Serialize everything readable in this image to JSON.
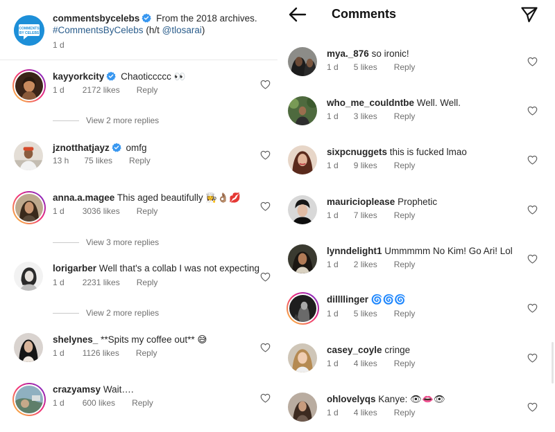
{
  "post": {
    "caption_user": "commentsbycelebs",
    "caption_text": "From the 2018 archives.",
    "caption_tags": "#CommentsByCelebs",
    "caption_credit_pre": "(h/t",
    "caption_credit_user": "@tlosarai",
    "caption_credit_post": ")",
    "caption_time": "1 d",
    "logo_text_1": "COMMENTS",
    "logo_text_2": "BY CELEBS"
  },
  "left_comments": [
    {
      "user": "kayyorkcity",
      "verified": true,
      "text": "Chaoticcccc",
      "emoji": "👀",
      "time": "1 d",
      "likes": "2172 likes",
      "reply": "Reply"
    },
    {
      "user": "jznotthatjayz",
      "verified": true,
      "text": "omfg",
      "emoji": "",
      "time": "13 h",
      "likes": "75 likes",
      "reply": "Reply"
    },
    {
      "user": "anna.a.magee",
      "verified": false,
      "text": "This aged beautifully",
      "emoji": "👩‍🍳👌🏽💋",
      "time": "1 d",
      "likes": "3036 likes",
      "reply": "Reply"
    },
    {
      "user": "lorigarber",
      "verified": false,
      "text": "Well that's a collab I was not expecting",
      "emoji": "",
      "time": "1 d",
      "likes": "2231 likes",
      "reply": "Reply"
    },
    {
      "user": "shelynes_",
      "verified": false,
      "text": "**Spits my coffee out**",
      "emoji": "😅",
      "time": "1 d",
      "likes": "1126 likes",
      "reply": "Reply"
    },
    {
      "user": "crazyamsy",
      "verified": false,
      "text": "Wait….",
      "emoji": "",
      "time": "1 d",
      "likes": "600 likes",
      "reply": "Reply"
    }
  ],
  "view_more": [
    "View 2 more replies",
    "View 3 more replies",
    "View 2 more replies"
  ],
  "right_header": {
    "title": "Comments"
  },
  "right_comments": [
    {
      "user": "mya._876",
      "text": "so ironic!",
      "emoji": "",
      "time": "1 d",
      "likes": "5 likes",
      "reply": "Reply"
    },
    {
      "user": "who_me_couldntbe",
      "text": "Well. Well.",
      "emoji": "",
      "time": "1 d",
      "likes": "3 likes",
      "reply": "Reply"
    },
    {
      "user": "sixpcnuggets",
      "text": "this is fucked lmao",
      "emoji": "",
      "time": "1 d",
      "likes": "9 likes",
      "reply": "Reply"
    },
    {
      "user": "mauricioplease",
      "text": "Prophetic",
      "emoji": "",
      "time": "1 d",
      "likes": "7 likes",
      "reply": "Reply"
    },
    {
      "user": "lynndelight1",
      "text": "Ummmmm No Kim! Go Ari! Lol",
      "emoji": "",
      "time": "1 d",
      "likes": "2 likes",
      "reply": "Reply"
    },
    {
      "user": "dillllinger",
      "text": "",
      "emoji": "🌀🌀🌀",
      "time": "1 d",
      "likes": "5 likes",
      "reply": "Reply"
    },
    {
      "user": "casey_coyle",
      "text": "cringe",
      "emoji": "",
      "time": "1 d",
      "likes": "4 likes",
      "reply": "Reply"
    },
    {
      "user": "ohlovelyqs",
      "text": "Kanye:",
      "emoji": "👁👄👁",
      "time": "1 d",
      "likes": "4 likes",
      "reply": "Reply"
    }
  ],
  "colors": {
    "accent_link": "#2a5d8c",
    "verified_blue": "#3897f0",
    "meta_gray": "#6f6f6f",
    "ring_gradient": [
      "#f9ce34",
      "#ee2a7b",
      "#6228d7"
    ]
  },
  "icons": {
    "back": "arrow-left-icon",
    "send": "paper-plane-icon",
    "like": "heart-outline-icon",
    "verified": "verified-badge-icon"
  }
}
